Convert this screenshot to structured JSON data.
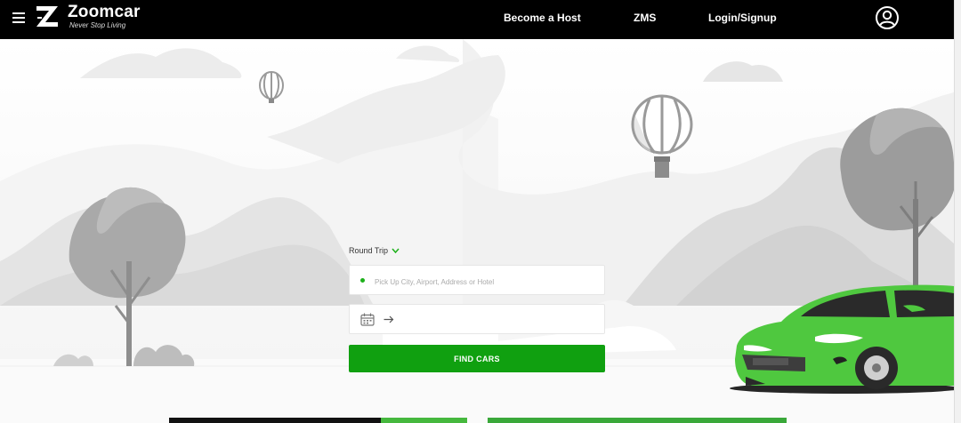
{
  "header": {
    "brand_name": "Zoomcar",
    "brand_tagline": "Never Stop Living",
    "nav": [
      {
        "label": "Become a Host"
      },
      {
        "label": "ZMS"
      },
      {
        "label": "Login/Signup"
      }
    ],
    "icons": {
      "menu": "hamburger-menu-icon",
      "logo": "zoomcar-z-logo",
      "user": "user-account-icon"
    }
  },
  "search": {
    "trip_type": "Round Trip",
    "pickup_placeholder": "Pick Up City, Airport, Address or Hotel",
    "pickup_value": "",
    "dates_value": "",
    "find_label": "FIND CARS"
  },
  "colors": {
    "brand_green": "#10a010",
    "header_bg": "#000000",
    "car_green": "#4fc83f"
  }
}
